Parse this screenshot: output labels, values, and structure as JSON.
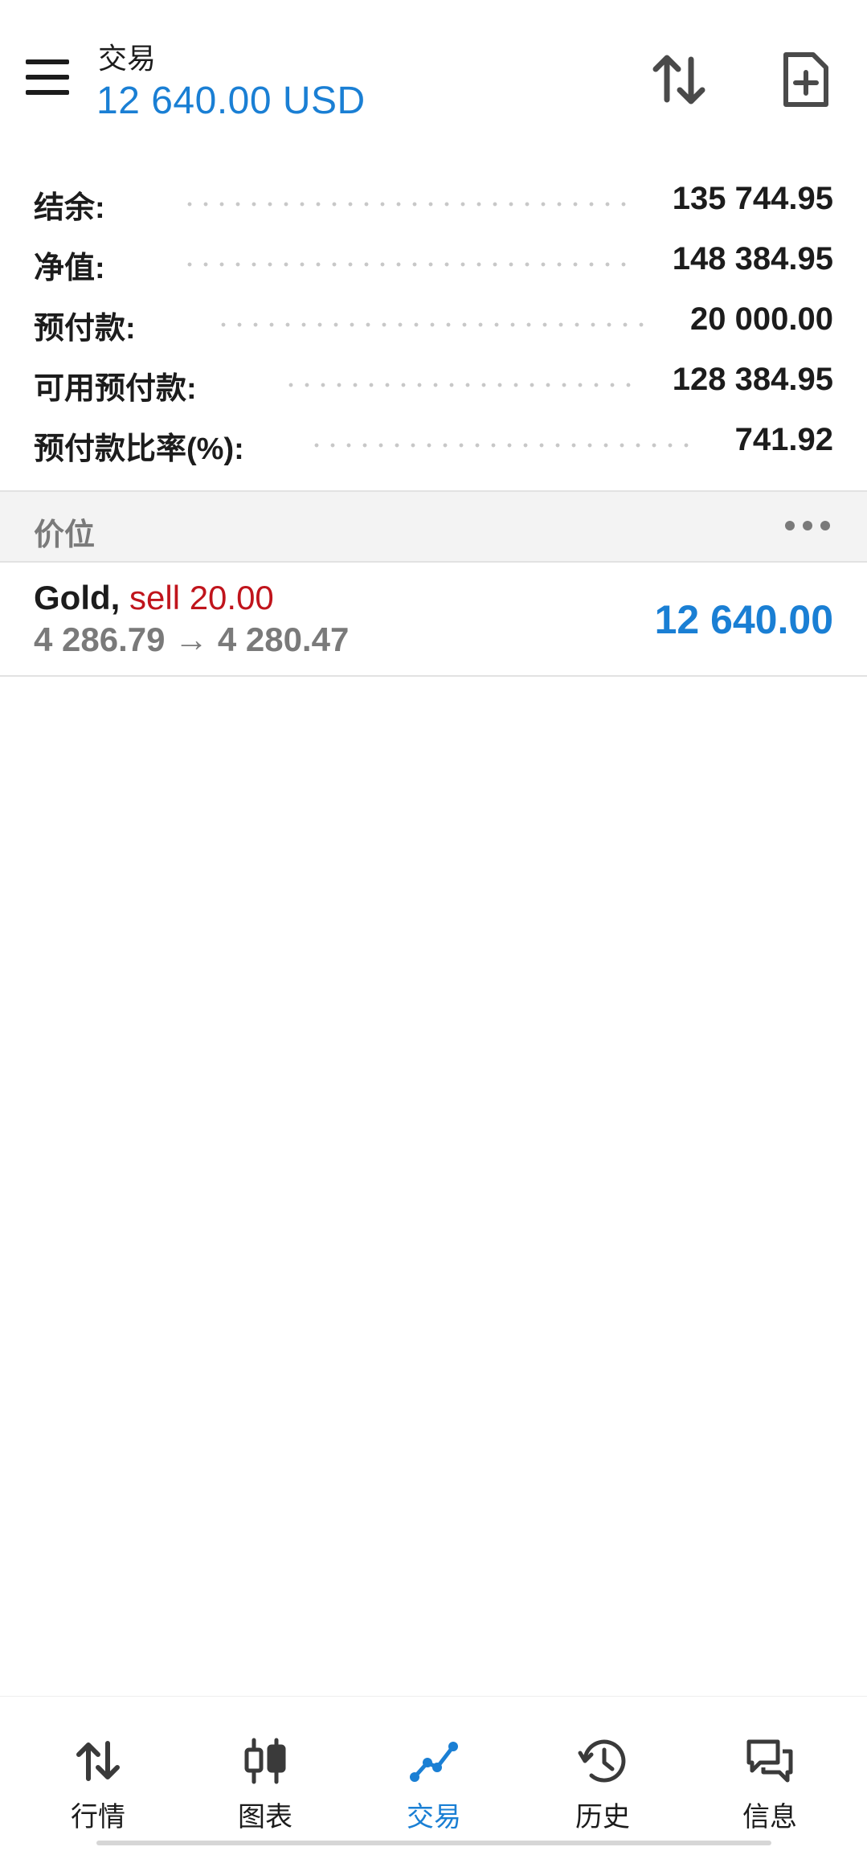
{
  "header": {
    "title": "交易",
    "subtitle": "12 640.00 USD"
  },
  "summary": [
    {
      "label": "结余:",
      "value": "135 744.95"
    },
    {
      "label": "净值:",
      "value": "148 384.95"
    },
    {
      "label": "预付款:",
      "value": "20 000.00"
    },
    {
      "label": "可用预付款:",
      "value": "128 384.95"
    },
    {
      "label": "预付款比率(%):",
      "value": "741.92"
    }
  ],
  "section": {
    "title": "价位"
  },
  "position": {
    "symbol": "Gold,",
    "side": "sell 20.00",
    "prices": "4 286.79 → 4 280.47",
    "profit": "12 640.00"
  },
  "nav": [
    {
      "label": "行情",
      "icon": "quotes-arrows-icon"
    },
    {
      "label": "图表",
      "icon": "candlestick-chart-icon"
    },
    {
      "label": "交易",
      "icon": "trade-line-icon"
    },
    {
      "label": "历史",
      "icon": "history-clock-icon"
    },
    {
      "label": "信息",
      "icon": "messages-chat-icon"
    }
  ],
  "colors": {
    "accent": "#1a7fd4",
    "sell": "#c0141c",
    "muted": "#7a7a7a"
  }
}
